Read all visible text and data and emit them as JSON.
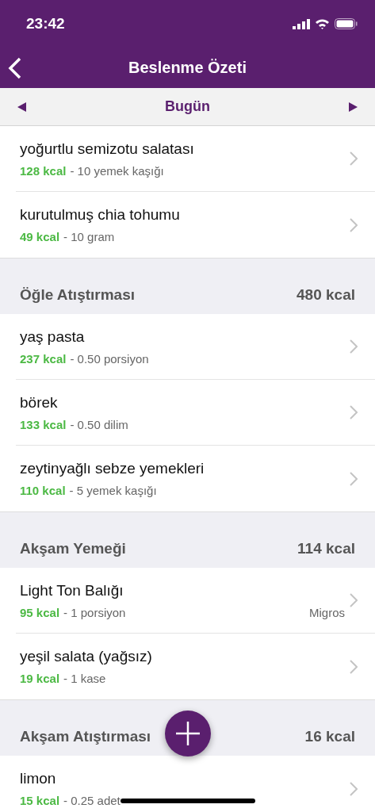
{
  "status_bar": {
    "time": "23:42"
  },
  "nav": {
    "title": "Beslenme Özeti"
  },
  "date_bar": {
    "label": "Bugün"
  },
  "sections": [
    {
      "items": [
        {
          "name": "yoğurtlu semizotu salatası",
          "calories": "128 kcal",
          "serving": "- 10 yemek kaşığı"
        },
        {
          "name": "kurutulmuş chia tohumu",
          "calories": "49 kcal",
          "serving": "- 10 gram"
        }
      ]
    },
    {
      "title": "Öğle Atıştırması",
      "total": "480 kcal",
      "items": [
        {
          "name": "yaş pasta",
          "calories": "237 kcal",
          "serving": "- 0.50 porsiyon"
        },
        {
          "name": "börek",
          "calories": "133 kcal",
          "serving": "- 0.50 dilim"
        },
        {
          "name": "zeytinyağlı sebze yemekleri",
          "calories": "110 kcal",
          "serving": "- 5 yemek kaşığı"
        }
      ]
    },
    {
      "title": "Akşam Yemeği",
      "total": "114 kcal",
      "items": [
        {
          "name": "Light Ton Balığı",
          "calories": "95 kcal",
          "serving": "- 1 porsiyon",
          "brand": "Migros"
        },
        {
          "name": "yeşil salata (yağsız)",
          "calories": "19 kcal",
          "serving": "- 1 kase"
        }
      ]
    },
    {
      "title": "Akşam Atıştırması",
      "total": "16 kcal",
      "items": [
        {
          "name": "limon",
          "calories": "15 kcal",
          "serving": "- 0.25 adet"
        }
      ]
    }
  ]
}
